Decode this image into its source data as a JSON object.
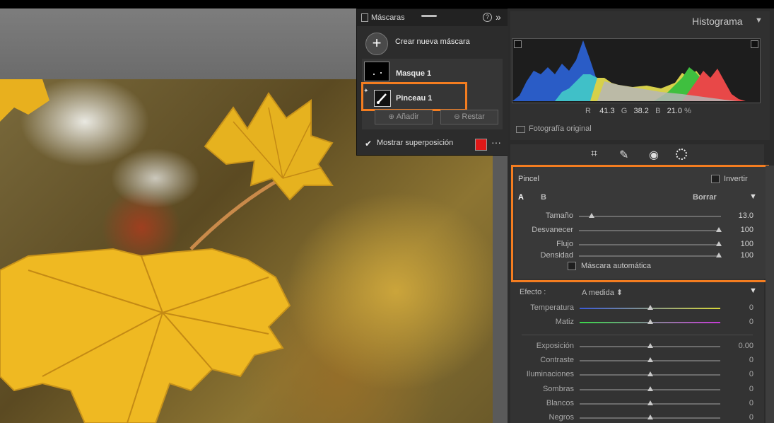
{
  "masks_panel": {
    "title": "Máscaras",
    "create_new_mask": "Crear nueva máscara",
    "masks": [
      {
        "label": "Masque 1"
      },
      {
        "label": "Pinceau 1"
      }
    ],
    "add_button": "Añadir",
    "subtract_button": "Restar",
    "show_overlay": "Mostrar superposición",
    "overlay_color": "#e01818"
  },
  "histogram": {
    "title": "Histograma",
    "r_label": "R",
    "r_value": "41.3",
    "g_label": "G",
    "g_value": "38.2",
    "b_label": "B",
    "b_value": "21.0",
    "percent": "%",
    "original_photo": "Fotografía original"
  },
  "brush": {
    "title": "Pincel",
    "invert": "Invertir",
    "tab_a": "A",
    "tab_b": "B",
    "erase": "Borrar",
    "sliders": [
      {
        "label": "Tamaño",
        "value": "13.0",
        "level": 0.07
      },
      {
        "label": "Desvanecer",
        "value": "100",
        "level": 1.0
      },
      {
        "label": "Flujo",
        "value": "100",
        "level": 1.0
      },
      {
        "label": "Densidad",
        "value": "100",
        "level": 1.0
      }
    ],
    "auto_mask": "Máscara automática"
  },
  "effect": {
    "label": "Efecto :",
    "value": "A medida",
    "sliders": [
      {
        "label": "Temperatura",
        "value": "0"
      },
      {
        "label": "Matiz",
        "value": "0"
      },
      {
        "label": "Exposición",
        "value": "0.00"
      },
      {
        "label": "Contraste",
        "value": "0"
      },
      {
        "label": "Iluminaciones",
        "value": "0"
      },
      {
        "label": "Sombras",
        "value": "0"
      },
      {
        "label": "Blancos",
        "value": "0"
      },
      {
        "label": "Negros",
        "value": "0"
      }
    ]
  },
  "colors": {
    "highlight": "#f47d20",
    "panel_bg": "#2b2b2b"
  }
}
